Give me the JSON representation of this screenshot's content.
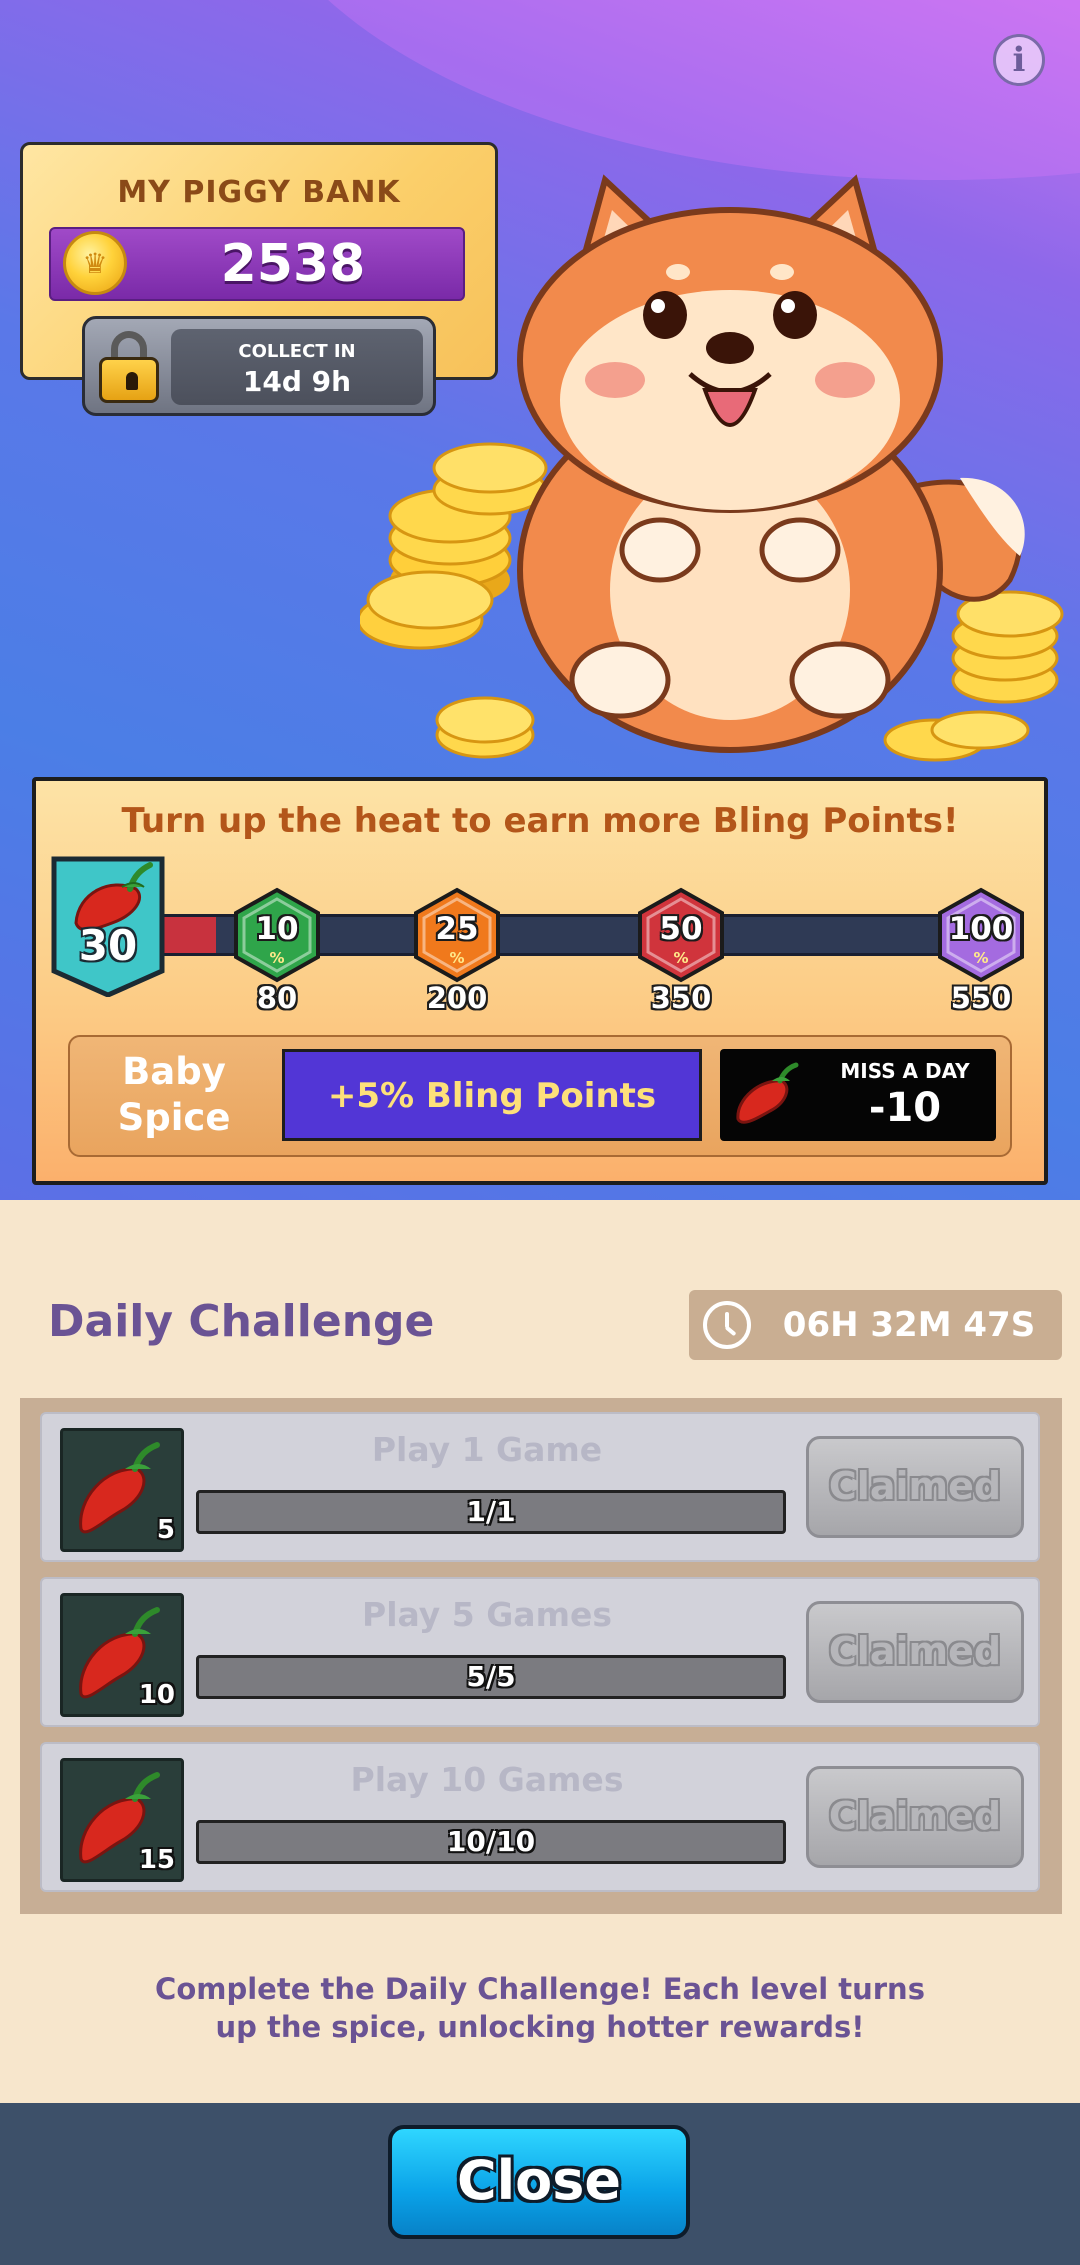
{
  "piggy_bank": {
    "title": "MY PIGGY BANK",
    "amount": "2538",
    "collect_label": "COLLECT IN",
    "collect_time": "14d 9h"
  },
  "spice": {
    "headline": "Turn up the heat to earn more Bling Points!",
    "current_level": "30",
    "progress_fraction": 0.07,
    "milestones": [
      {
        "value": "10",
        "pct": "%",
        "requirement": "80",
        "color": "#2fa54a"
      },
      {
        "value": "25",
        "pct": "%",
        "requirement": "200",
        "color": "#f0791c"
      },
      {
        "value": "50",
        "pct": "%",
        "requirement": "350",
        "color": "#d0343c"
      },
      {
        "value": "100",
        "pct": "%",
        "requirement": "550",
        "color": "#a46be0"
      }
    ],
    "tier_name_line1": "Baby",
    "tier_name_line2": "Spice",
    "tier_bonus": "+5% Bling Points",
    "miss_label": "MISS A DAY",
    "miss_value": "-10"
  },
  "daily_challenge": {
    "title": "Daily Challenge",
    "timer": "06H 32M 47S",
    "items": [
      {
        "task": "Play 1 Game",
        "reward": "5",
        "progress": "1/1",
        "button": "Claimed"
      },
      {
        "task": "Play 5 Games",
        "reward": "10",
        "progress": "5/5",
        "button": "Claimed"
      },
      {
        "task": "Play 10 Games",
        "reward": "15",
        "progress": "10/10",
        "button": "Claimed"
      }
    ],
    "footer_line1": "Complete the Daily Challenge! Each level turns",
    "footer_line2": "up the spice, unlocking hotter rewards!"
  },
  "close_button": "Close",
  "colors": {
    "accent_purple": "#6a5394",
    "bonus_bar": "#5236d6",
    "close_button": "#0aa2e8"
  }
}
